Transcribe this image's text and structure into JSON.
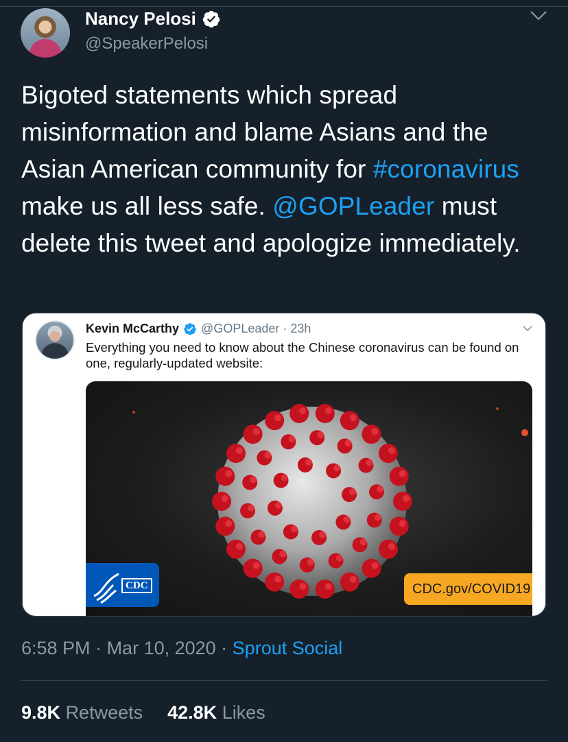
{
  "author": {
    "name": "Nancy Pelosi",
    "handle": "@SpeakerPelosi",
    "verified_icon": "verified-badge-icon"
  },
  "tweet": {
    "text_parts": [
      {
        "text": "Bigoted statements which spread misinformation and blame Asians and the Asian American community for ",
        "type": "text"
      },
      {
        "text": "#coronavirus",
        "type": "hashtag"
      },
      {
        "text": " make us all less safe. ",
        "type": "text"
      },
      {
        "text": "@GOPLeader",
        "type": "mention"
      },
      {
        "text": " must delete this tweet and apologize immediately.",
        "type": "text"
      }
    ]
  },
  "quoted": {
    "name": "Kevin McCarthy",
    "handle_time": "@GOPLeader · 23h",
    "text": "Everything you need to know about the Chinese coronavirus can be found on one, regularly-updated website:",
    "media": {
      "logo_text": "CDC",
      "url_text": "CDC.gov/COVID19"
    }
  },
  "meta": {
    "time": "6:58 PM",
    "separator": " · ",
    "date": "Mar 10, 2020",
    "source": "Sprout Social"
  },
  "stats": {
    "retweets_count": "9.8K",
    "retweets_label": "Retweets",
    "likes_count": "42.8K",
    "likes_label": "Likes"
  },
  "colors": {
    "background": "#15202b",
    "link": "#1da1f2",
    "muted": "#8899a6"
  }
}
